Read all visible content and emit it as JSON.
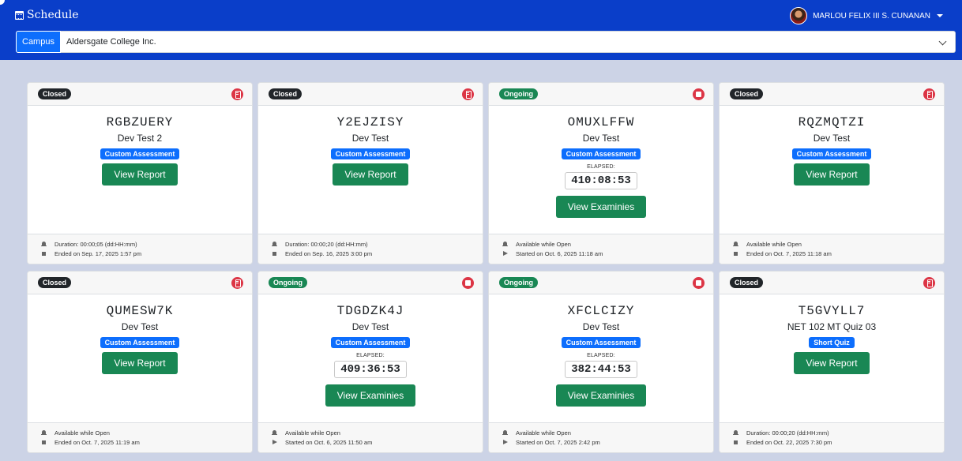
{
  "header": {
    "title": "Schedule",
    "user_name": "MARLOU FELIX III S. CUNANAN"
  },
  "campus": {
    "label": "Campus",
    "selected": "Aldersgate College Inc."
  },
  "labels": {
    "elapsed": "ELAPSED:"
  },
  "colors": {
    "header_bg": "#0a3ec9",
    "closed_badge": "#212529",
    "ongoing_badge": "#198754",
    "type_badge": "#0d6efd",
    "action_button": "#198754",
    "status_icon": "#dc3545"
  },
  "cards": [
    {
      "status": "Closed",
      "status_icon": "document-icon",
      "code": "RGBZUERY",
      "title": "Dev Test 2",
      "type": "Custom Assessment",
      "elapsed": "",
      "button": "View Report",
      "foot_icon_1": "bell-icon",
      "foot_line_1": "Duration: 00:00;05 (dd:HH:mm)",
      "foot_icon_2": "stop-square-icon",
      "foot_line_2": "Ended on Sep. 17, 2025 1:57 pm"
    },
    {
      "status": "Closed",
      "status_icon": "document-icon",
      "code": "Y2EJZISY",
      "title": "Dev Test",
      "type": "Custom Assessment",
      "elapsed": "",
      "button": "View Report",
      "foot_icon_1": "bell-icon",
      "foot_line_1": "Duration: 00:00;20 (dd:HH:mm)",
      "foot_icon_2": "stop-square-icon",
      "foot_line_2": "Ended on Sep. 16, 2025 3:00 pm"
    },
    {
      "status": "Ongoing",
      "status_icon": "stop-icon",
      "code": "OMUXLFFW",
      "title": "Dev Test",
      "type": "Custom Assessment",
      "elapsed": "410:08:53",
      "button": "View Examinies",
      "foot_icon_1": "bell-icon",
      "foot_line_1": "Available while Open",
      "foot_icon_2": "play-icon",
      "foot_line_2": "Started on Oct. 6, 2025 11:18 am"
    },
    {
      "status": "Closed",
      "status_icon": "document-icon",
      "code": "RQZMQTZI",
      "title": "Dev Test",
      "type": "Custom Assessment",
      "elapsed": "",
      "button": "View Report",
      "foot_icon_1": "bell-icon",
      "foot_line_1": "Available while Open",
      "foot_icon_2": "stop-square-icon",
      "foot_line_2": "Ended on Oct. 7, 2025 11:18 am"
    },
    {
      "status": "Closed",
      "status_icon": "document-icon",
      "code": "QUMESW7K",
      "title": "Dev Test",
      "type": "Custom Assessment",
      "elapsed": "",
      "button": "View Report",
      "foot_icon_1": "bell-icon",
      "foot_line_1": "Available while Open",
      "foot_icon_2": "stop-square-icon",
      "foot_line_2": "Ended on Oct. 7, 2025 11:19 am"
    },
    {
      "status": "Ongoing",
      "status_icon": "stop-icon",
      "code": "TDGDZK4J",
      "title": "Dev Test",
      "type": "Custom Assessment",
      "elapsed": "409:36:53",
      "button": "View Examinies",
      "foot_icon_1": "bell-icon",
      "foot_line_1": "Available while Open",
      "foot_icon_2": "play-icon",
      "foot_line_2": "Started on Oct. 6, 2025 11:50 am"
    },
    {
      "status": "Ongoing",
      "status_icon": "stop-icon",
      "code": "XFCLCIZY",
      "title": "Dev Test",
      "type": "Custom Assessment",
      "elapsed": "382:44:53",
      "button": "View Examinies",
      "foot_icon_1": "bell-icon",
      "foot_line_1": "Available while Open",
      "foot_icon_2": "play-icon",
      "foot_line_2": "Started on Oct. 7, 2025 2:42 pm"
    },
    {
      "status": "Closed",
      "status_icon": "document-icon",
      "code": "T5GVYLL7",
      "title": "NET 102 MT Quiz 03",
      "type": "Short Quiz",
      "elapsed": "",
      "button": "View Report",
      "foot_icon_1": "bell-icon",
      "foot_line_1": "Duration: 00:00;20 (dd:HH:mm)",
      "foot_icon_2": "stop-square-icon",
      "foot_line_2": "Ended on Oct. 22, 2025 7:30 pm"
    }
  ]
}
